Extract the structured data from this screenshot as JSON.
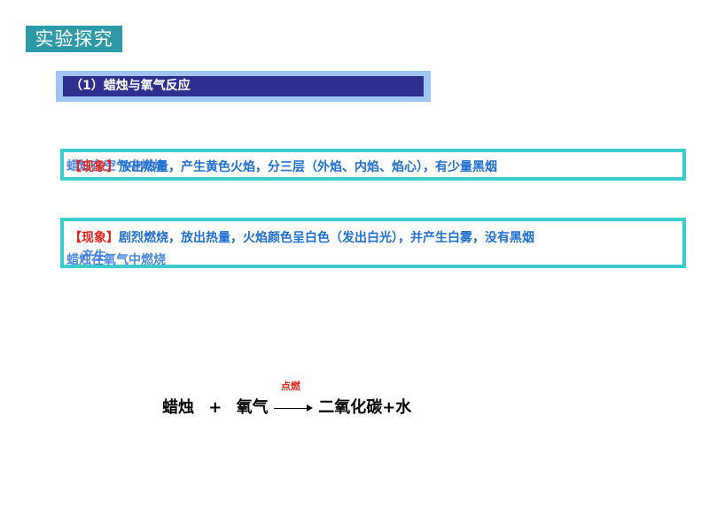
{
  "section_tag": "实验探究",
  "heading": "（1）蜡烛与氧气反应",
  "box1": {
    "ghost_text": "蜡烛在空气中燃烧",
    "label": "【现象】",
    "text": "放出热量，产生黄色火焰，分三层（外焰、内焰、焰心），有少量黑烟"
  },
  "box2": {
    "label": "【现象】",
    "text": "剧烈燃烧，放出热量，火焰颜色呈白色（发出白光），并产生白雾，没有黑烟",
    "ghost_text": "蜡烛在氧气中燃烧",
    "ghost_overlap": "产生"
  },
  "equation": {
    "reactant1": "蜡烛",
    "plus": "+",
    "reactant2": "氧气",
    "condition": "点燃",
    "products": "二氧化碳+水"
  },
  "colors": {
    "tag_bg": "#2e9aa7",
    "heading_outer": "#9ec5f4",
    "heading_inner": "#2e2e8f",
    "box_border": "#3ccccc",
    "label_red": "#e0251c",
    "text_blue": "#1f6fd0"
  }
}
